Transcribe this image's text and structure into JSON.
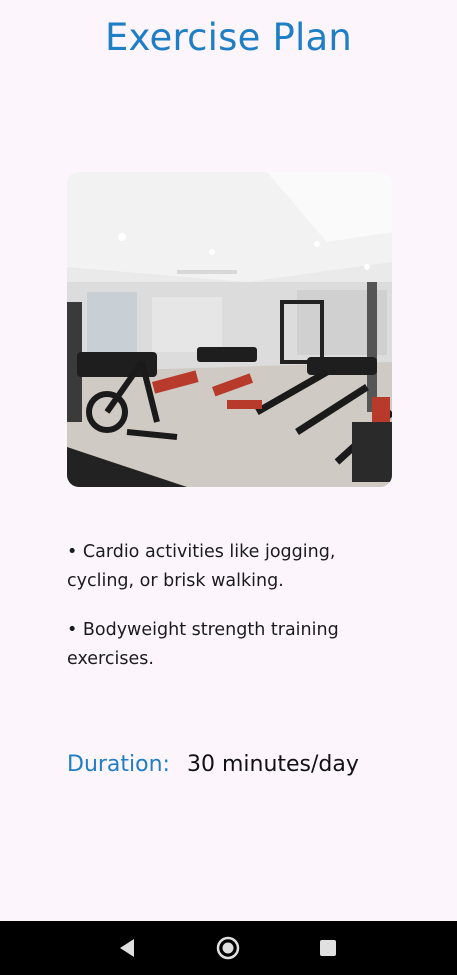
{
  "header": {
    "title": "Exercise Plan"
  },
  "image": {
    "icon": "gym-photo"
  },
  "bullets": [
    "• Cardio activities like jogging, cycling, or brisk walking.",
    "• Bodyweight strength training exercises."
  ],
  "duration": {
    "label": "Duration:",
    "value": "30 minutes/day"
  },
  "nav": {
    "back_icon": "back-triangle",
    "home_icon": "home-circle",
    "recents_icon": "recents-square"
  },
  "colors": {
    "accent": "#1f7fc6",
    "background": "#fcf5fc"
  }
}
